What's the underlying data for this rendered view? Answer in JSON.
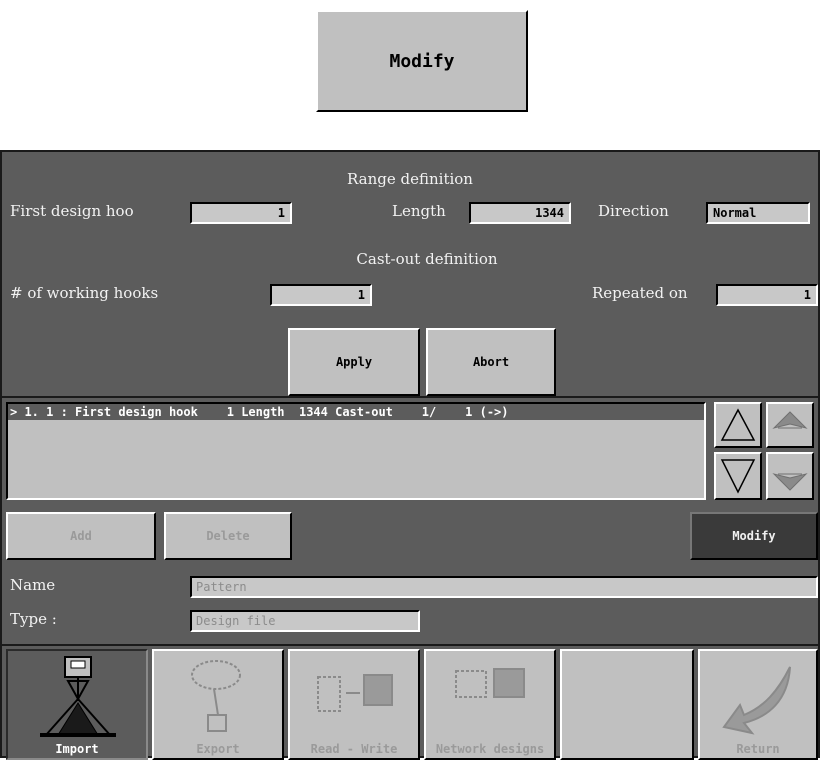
{
  "top_button": {
    "label": "Modify"
  },
  "range": {
    "section_title": "Range definition",
    "first_hook_label": "First design hoo",
    "first_hook_value": "1",
    "length_label": "Length",
    "length_value": "1344",
    "direction_label": "Direction",
    "direction_value": "Normal"
  },
  "castout": {
    "section_title": "Cast-out definition",
    "working_hooks_label": "# of working hooks",
    "working_hooks_value": "1",
    "repeated_label": "Repeated on",
    "repeated_value": "1"
  },
  "actions": {
    "apply": "Apply",
    "abort": "Abort"
  },
  "list": {
    "items": [
      "> 1. 1 : First design hook    1 Length  1344 Cast-out    1/    1 (->)"
    ]
  },
  "list_actions": {
    "add": "Add",
    "delete": "Delete",
    "modify": "Modify"
  },
  "name_label": "Name",
  "name_value": "Pattern",
  "type_label": "Type :",
  "type_value": "Design file",
  "toolbar": {
    "items": [
      {
        "label": "Import",
        "icon": "import-icon",
        "active": true
      },
      {
        "label": "Export",
        "icon": "export-icon",
        "active": false
      },
      {
        "label": "Read - Write",
        "icon": "read-write-icon",
        "active": false
      },
      {
        "label": "Network designs",
        "icon": "network-designs-icon",
        "active": false
      },
      {
        "label": "",
        "icon": "",
        "active": false
      },
      {
        "label": "Return",
        "icon": "return-icon",
        "active": false
      }
    ]
  },
  "colors": {
    "panel": "#5c5c5c",
    "button": "#c0c0c0",
    "field": "#c8c8c8",
    "dark_button": "#3a3a3a"
  }
}
